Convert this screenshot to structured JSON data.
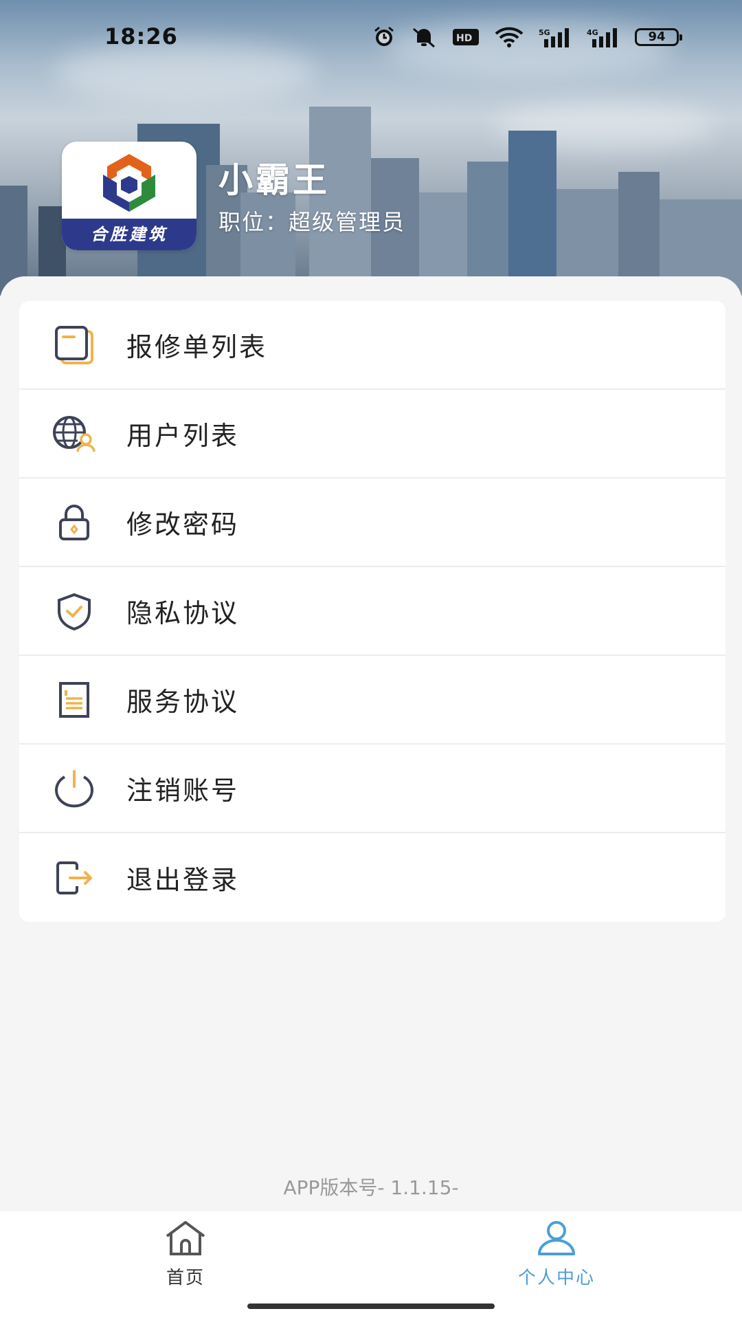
{
  "status_bar": {
    "time": "18:26",
    "battery": "94",
    "network_labels": [
      "5G",
      "4G"
    ],
    "icons": [
      "alarm-icon",
      "mute-icon",
      "hd-icon",
      "wifi-icon",
      "signal-5g-icon",
      "signal-4g-icon",
      "battery-icon"
    ]
  },
  "profile": {
    "logo_text": "合胜建筑",
    "name": "小霸王",
    "role": "职位：超级管理员"
  },
  "menu": {
    "items": [
      {
        "label": "报修单列表",
        "icon": "document-list-icon"
      },
      {
        "label": "用户列表",
        "icon": "user-globe-icon"
      },
      {
        "label": "修改密码",
        "icon": "lock-icon"
      },
      {
        "label": "隐私协议",
        "icon": "shield-check-icon"
      },
      {
        "label": "服务协议",
        "icon": "document-icon"
      },
      {
        "label": "注销账号",
        "icon": "power-icon"
      },
      {
        "label": "退出登录",
        "icon": "logout-icon"
      }
    ]
  },
  "version": "APP版本号- 1.1.15-",
  "tabbar": {
    "tabs": [
      {
        "label": "首页",
        "icon": "home-icon",
        "active": false
      },
      {
        "label": "个人中心",
        "icon": "user-icon",
        "active": true
      }
    ]
  },
  "colors": {
    "accent": "#f0b34a",
    "icon_dark": "#3d4257",
    "tab_active": "#4a9fd8",
    "tab_inactive": "#333333",
    "logo_blue": "#2d3a8c",
    "logo_orange": "#e2621b",
    "logo_green": "#2e8b3e"
  }
}
